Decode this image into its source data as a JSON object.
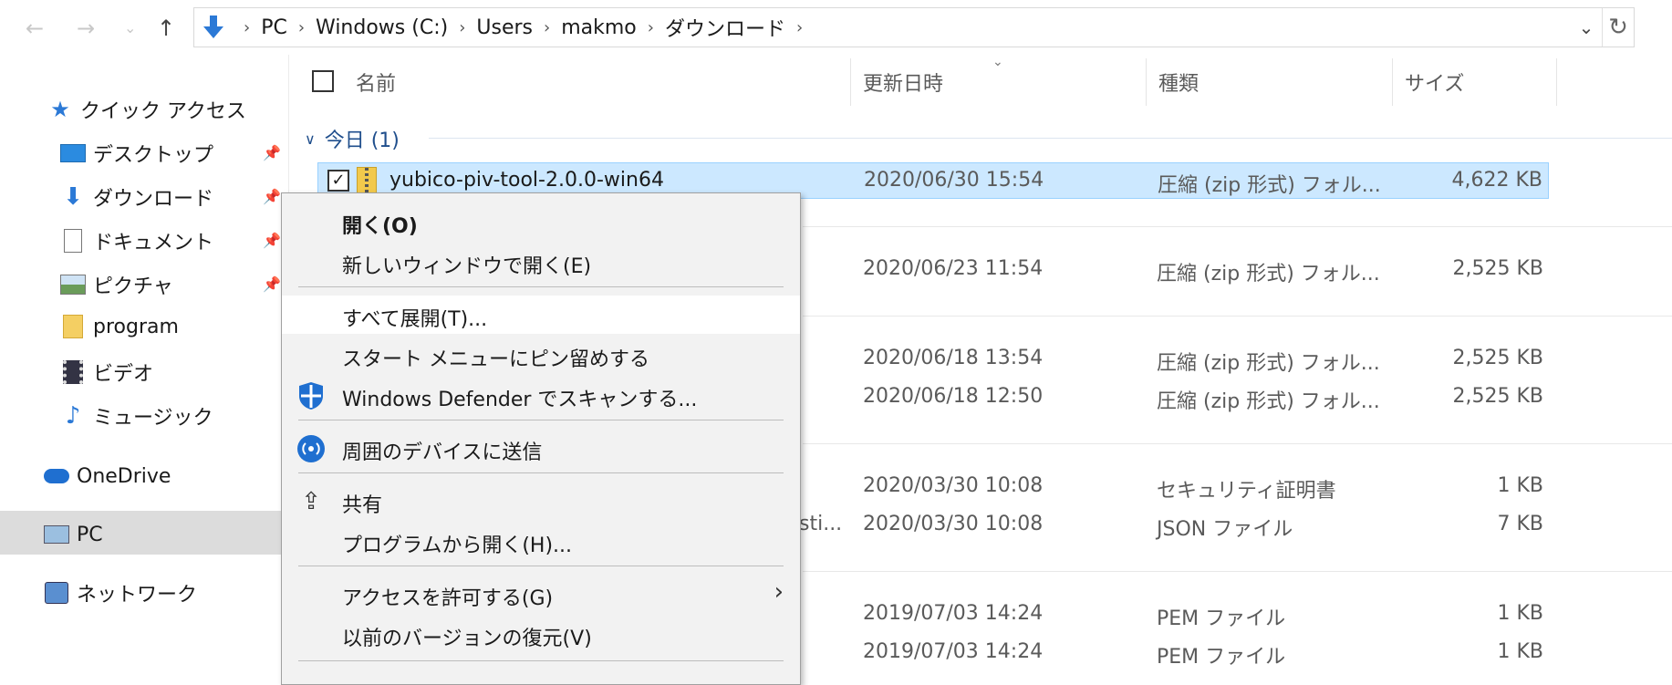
{
  "address_bar": {
    "breadcrumbs": [
      "PC",
      "Windows (C:)",
      "Users",
      "makmo",
      "ダウンロード"
    ]
  },
  "nav": {
    "quick_access": "クイック アクセス",
    "items": [
      "デスクトップ",
      "ダウンロード",
      "ドキュメント",
      "ピクチャ",
      "program",
      "ビデオ",
      "ミュージック"
    ],
    "onedrive": "OneDrive",
    "pc": "PC",
    "network": "ネットワーク"
  },
  "columns": {
    "name": "名前",
    "date": "更新日時",
    "type": "種類",
    "size": "サイズ"
  },
  "group_today": "今日 (1)",
  "rows": [
    {
      "name": "yubico-piv-tool-2.0.0-win64",
      "date": "2020/06/30 15:54",
      "type": "圧縮 (zip 形式) フォル...",
      "size": "4,622 KB"
    },
    {
      "name": "",
      "date": "2020/06/23 11:54",
      "type": "圧縮 (zip 形式) フォル...",
      "size": "2,525 KB"
    },
    {
      "name": "",
      "date": "2020/06/18 13:54",
      "type": "圧縮 (zip 形式) フォル...",
      "size": "2,525 KB"
    },
    {
      "name": "",
      "date": "2020/06/18 12:50",
      "type": "圧縮 (zip 形式) フォル...",
      "size": "2,525 KB"
    },
    {
      "name": "",
      "date": "2020/03/30 10:08",
      "type": "セキュリティ証明書",
      "size": "1 KB"
    },
    {
      "name": "sti...",
      "date": "2020/03/30 10:08",
      "type": "JSON ファイル",
      "size": "7 KB"
    },
    {
      "name": "",
      "date": "2019/07/03 14:24",
      "type": "PEM ファイル",
      "size": "1 KB"
    },
    {
      "name": "",
      "date": "2019/07/03 14:24",
      "type": "PEM ファイル",
      "size": "1 KB"
    }
  ],
  "context_menu": {
    "open": "開く(O)",
    "open_new_window": "新しいウィンドウで開く(E)",
    "extract_all": "すべて展開(T)...",
    "pin_start": "スタート メニューにピン留めする",
    "defender": "Windows Defender でスキャンする...",
    "nearby_share": "周囲のデバイスに送信",
    "share": "共有",
    "open_with": "プログラムから開く(H)...",
    "give_access": "アクセスを許可する(G)",
    "restore_versions": "以前のバージョンの復元(V)"
  }
}
